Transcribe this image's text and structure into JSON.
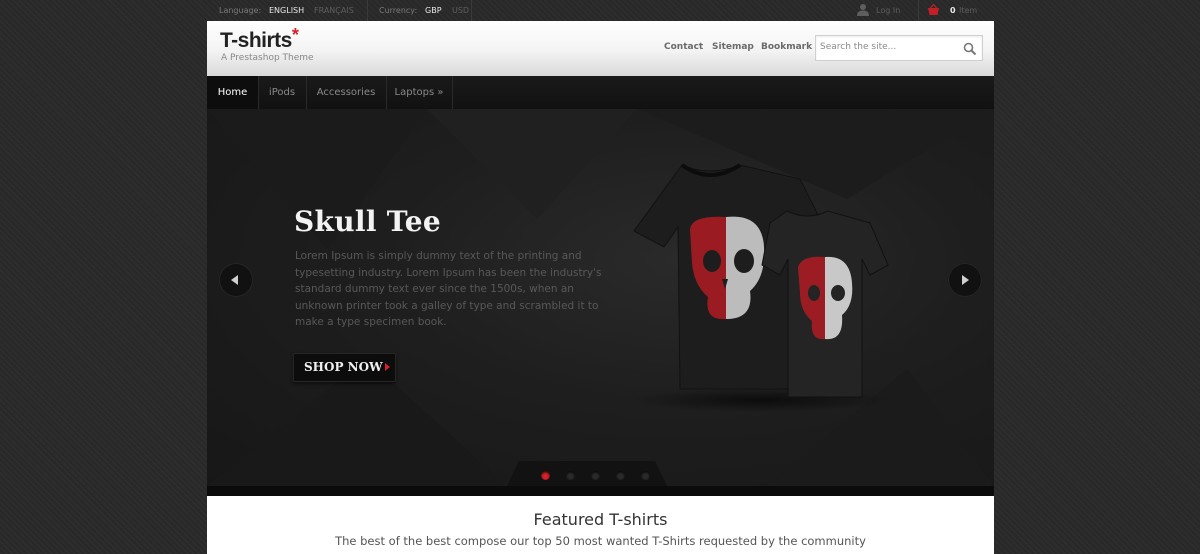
{
  "topbar": {
    "language_label": "Language:",
    "languages": [
      "ENGLISH",
      "FRANÇAIS"
    ],
    "currency_label": "Currency:",
    "currencies": [
      "GBP",
      "USD"
    ],
    "login_label": "Log In",
    "cart_count": "0",
    "cart_unit": "Item"
  },
  "header": {
    "logo_text": "T-shirts",
    "logo_star": "*",
    "tagline": "A Prestashop Theme",
    "links": [
      "Contact",
      "Sitemap",
      "Bookmark"
    ],
    "search_placeholder": "Search the site..."
  },
  "nav": {
    "items": [
      "Home",
      "iPods",
      "Accessories",
      "Laptops »"
    ],
    "active": "Home"
  },
  "hero": {
    "title": "Skull Tee",
    "text": "Lorem Ipsum is simply dummy text of the printing and typesetting industry. Lorem Ipsum has been the industry's standard dummy text ever since the 1500s, when an unknown printer took a galley of type and scrambled it to make a type specimen book.",
    "cta": "SHOP NOW",
    "slide_count": 5,
    "active_slide": 1
  },
  "featured": {
    "title": "Featured T-shirts",
    "subtitle": "The best of the best compose our top 50 most wanted T-Shirts requested by the community"
  },
  "colors": {
    "accent": "#d6202a",
    "background": "#2a2a2a",
    "hero_bg": "#1e1e1e"
  }
}
